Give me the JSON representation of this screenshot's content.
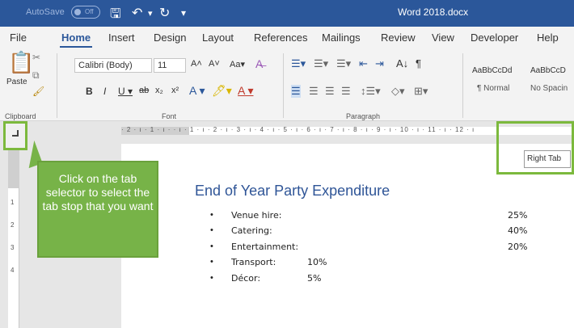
{
  "titlebar": {
    "autosave": "AutoSave",
    "autosave_state": "Off",
    "doc_title": "Word 2018.docx"
  },
  "tabs": [
    "File",
    "Home",
    "Insert",
    "Design",
    "Layout",
    "References",
    "Mailings",
    "Review",
    "View",
    "Developer",
    "Help"
  ],
  "ribbon": {
    "clipboard": {
      "paste": "Paste",
      "label": "Clipboard"
    },
    "font": {
      "name": "Calibri (Body)",
      "size": "11",
      "label": "Font"
    },
    "paragraph": {
      "label": "Paragraph"
    },
    "styles": [
      {
        "preview": "AaBbCcDd",
        "name": "¶ Normal"
      },
      {
        "preview": "AaBbCcD",
        "name": "No Spacin"
      }
    ]
  },
  "ruler": {
    "ticks": "· 2 · ı · 1 · ı ·   · ı · 1 · ı · 2 · ı · 3 · ı · 4 · ı · 5 · ı · 6 · ı · 7 · ı · 8 · ı · 9 · ı · 10 · ı · 11 · ı · 12 · ı"
  },
  "document": {
    "title": "End of Year Party Expenditure",
    "items": [
      {
        "label": "Venue hire:",
        "value": "25%"
      },
      {
        "label": "Catering:",
        "value": "40%"
      },
      {
        "label": "Entertainment:",
        "value": "20%"
      },
      {
        "label": "Transport:",
        "value": "10%"
      },
      {
        "label": "Décor:",
        "value": "5%"
      }
    ]
  },
  "callout": {
    "text": "Click on the tab selector to select the tab stop that you want"
  },
  "tooltip": {
    "text": "Right Tab"
  },
  "colors": {
    "word_blue": "#2b579a",
    "callout_green": "#77b348",
    "heading_blue": "#2f5597"
  }
}
